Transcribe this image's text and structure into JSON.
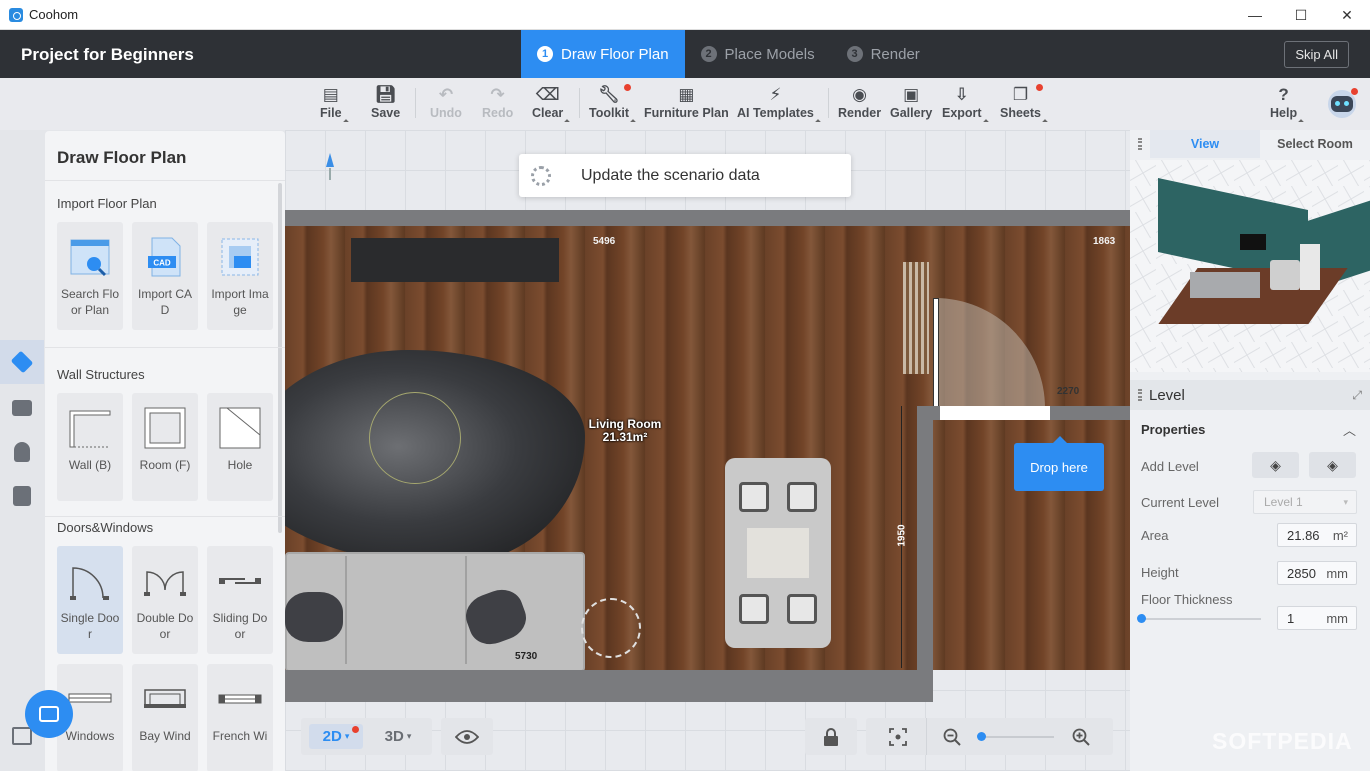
{
  "window": {
    "app_name": "Coohom",
    "minimize": "—",
    "maximize": "☐",
    "close": "✕"
  },
  "header": {
    "project_title": "Project for Beginners",
    "steps": [
      {
        "num": "1",
        "label": "Draw Floor Plan",
        "active": true
      },
      {
        "num": "2",
        "label": "Place Models",
        "active": false
      },
      {
        "num": "3",
        "label": "Render",
        "active": false
      }
    ],
    "skip_label": "Skip All"
  },
  "toolbar": {
    "file": "File",
    "save": "Save",
    "undo": "Undo",
    "redo": "Redo",
    "clear": "Clear",
    "toolkit": "Toolkit",
    "furniture_plan": "Furniture Plan",
    "ai_templates": "AI Templates",
    "render": "Render",
    "gallery": "Gallery",
    "export": "Export",
    "sheets": "Sheets",
    "help": "Help"
  },
  "left_panel": {
    "title": "Draw Floor Plan",
    "sections": {
      "import": {
        "title": "Import Floor Plan",
        "items": [
          "Search Floor Plan",
          "Import CAD",
          "Import Image"
        ]
      },
      "walls": {
        "title": "Wall Structures",
        "items": [
          "Wall (B)",
          "Room (F)",
          "Hole"
        ]
      },
      "doors": {
        "title": "Doors&Windows",
        "items": [
          "Single Door",
          "Double Door",
          "Sliding Door",
          "Windows",
          "Bay Wind",
          "French Wi"
        ]
      }
    },
    "cad_badge": "CAD"
  },
  "canvas": {
    "toast": "Update the scenario data",
    "room_name": "Living Room",
    "room_area": "21.31m²",
    "dims": {
      "top_left": "5496",
      "top_right": "1863",
      "mid": "2270",
      "bottom": "5730",
      "vertical": "1950"
    },
    "drop_here": "Drop here",
    "view_2d": "2D",
    "view_3d": "3D"
  },
  "right_panel": {
    "tabs": [
      "View",
      "Select Room"
    ],
    "level_title": "Level",
    "properties": "Properties",
    "add_level": "Add Level",
    "current_level_label": "Current Level",
    "current_level_value": "Level 1",
    "area_label": "Area",
    "area_value": "21.86",
    "area_unit": "m²",
    "height_label": "Height",
    "height_value": "2850",
    "height_unit": "mm",
    "floor_thickness_label": "Floor Thickness",
    "floor_thickness_value": "1",
    "floor_thickness_unit": "mm"
  },
  "watermark": "SOFTPEDIA",
  "colors": {
    "accent": "#2d8df2",
    "header": "#2e3136",
    "notification": "#e8412f"
  }
}
